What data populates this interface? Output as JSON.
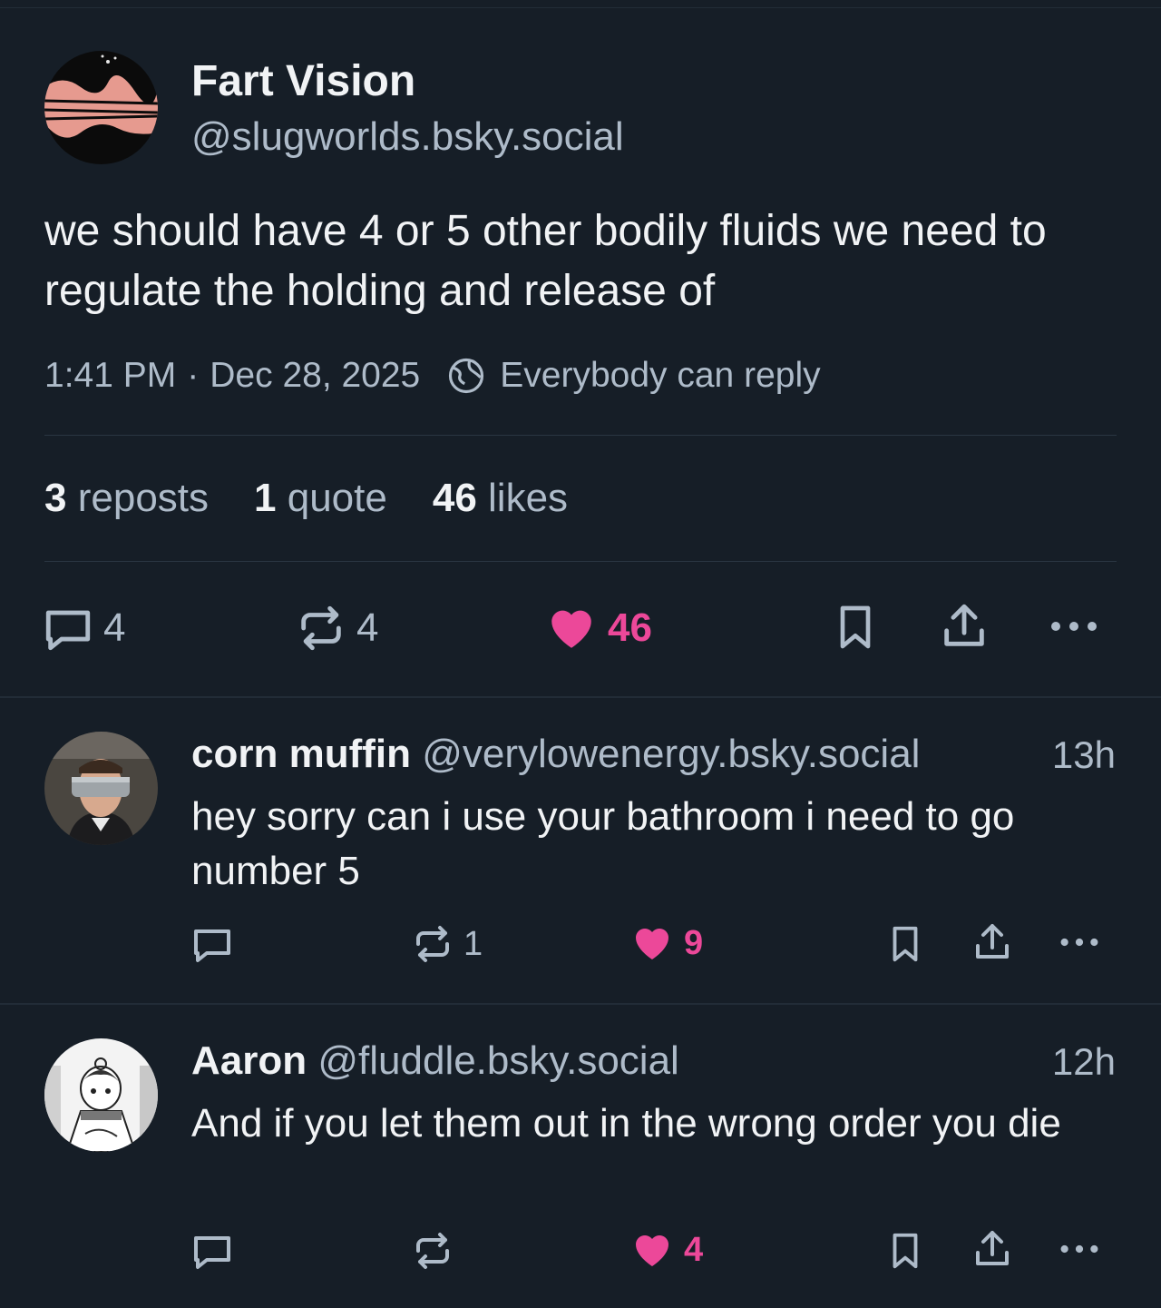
{
  "post": {
    "author": {
      "name": "Fart Vision",
      "handle": "@slugworlds.bsky.social"
    },
    "text": "we should have 4 or 5 other bodily fluids we need to regulate the holding and release of",
    "time": "1:41 PM",
    "separator": "·",
    "date": "Dec 28, 2025",
    "reply_setting": "Everybody can reply",
    "stats": {
      "reposts_count": "3",
      "reposts_label": "reposts",
      "quotes_count": "1",
      "quotes_label": "quote",
      "likes_count": "46",
      "likes_label": "likes"
    },
    "actions": {
      "replies": "4",
      "reposts": "4",
      "likes": "46"
    }
  },
  "replies": [
    {
      "name": "corn muffin",
      "handle": "@verylowenergy.bsky.social",
      "time": "13h",
      "text": "hey sorry can i use your bathroom i need to go number 5",
      "actions": {
        "replies": "",
        "reposts": "1",
        "likes": "9"
      }
    },
    {
      "name": "Aaron",
      "handle": "@fluddle.bsky.social",
      "time": "12h",
      "text": "And if you let them out in the wrong order you die",
      "actions": {
        "replies": "",
        "reposts": "",
        "likes": "4"
      }
    }
  ],
  "colors": {
    "background": "#161e27",
    "text": "#f1f3f5",
    "muted": "#aebbc9",
    "like": "#ec4899",
    "divider": "#2a3542"
  },
  "icons": [
    "globe-icon",
    "reply-icon",
    "repost-icon",
    "heart-icon",
    "bookmark-icon",
    "share-icon",
    "more-icon"
  ]
}
